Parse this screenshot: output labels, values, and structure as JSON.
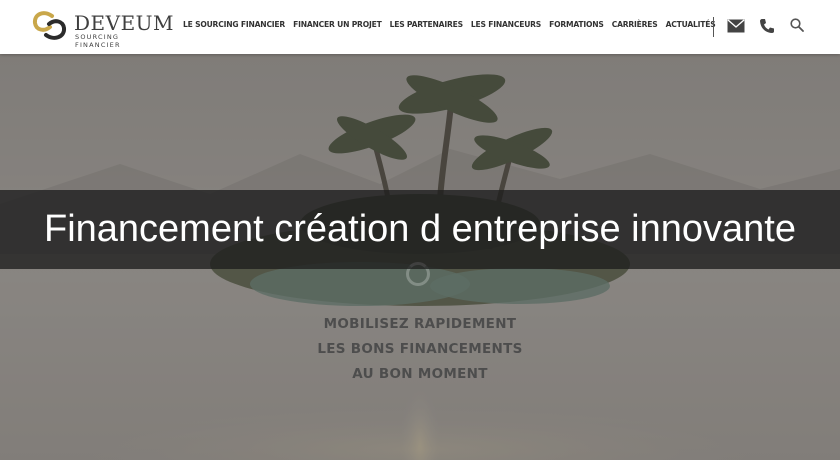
{
  "brand": {
    "name": "DEVEUM",
    "subtitle": "SOURCING FINANCIER"
  },
  "nav": [
    "LE SOURCING FINANCIER",
    "FINANCER UN PROJET",
    "LES PARTENAIRES",
    "LES FINANCEURS",
    "FORMATIONS",
    "CARRIÈRES",
    "ACTUALITÉS"
  ],
  "header_icons": [
    "mail-icon",
    "phone-icon",
    "search-icon"
  ],
  "hero": {
    "tagline": [
      "MOBILISEZ RAPIDEMENT",
      "LES BONS FINANCEMENTS",
      "AU BON MOMENT"
    ]
  },
  "page_title": "Financement création d entreprise innovante",
  "colors": {
    "header_bg": "#ffffff",
    "band_bg": "#1e1e1e",
    "logo_gold": "#c9a74a"
  }
}
